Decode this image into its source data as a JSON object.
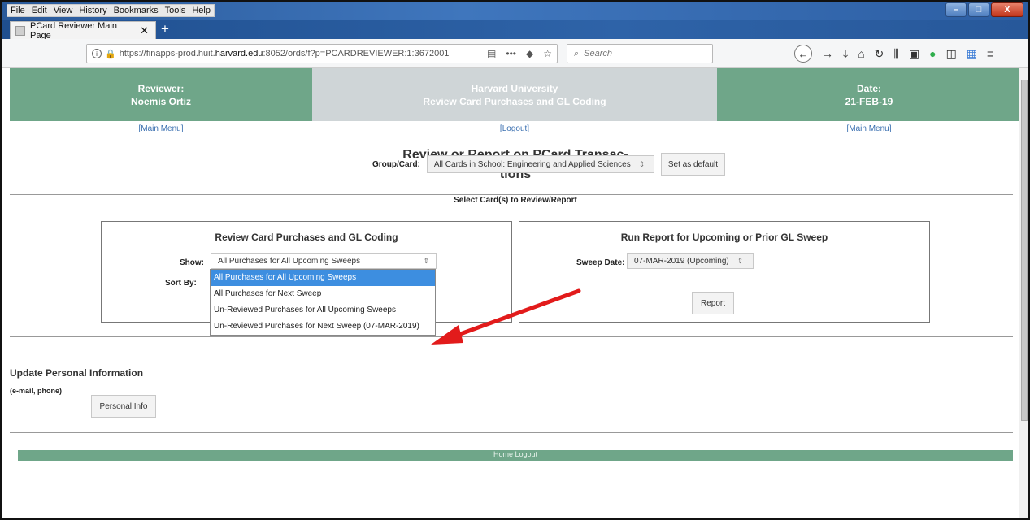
{
  "window": {
    "menu": [
      "File",
      "Edit",
      "View",
      "History",
      "Bookmarks",
      "Tools",
      "Help"
    ],
    "tab_title": "PCard Reviewer Main Page",
    "url_prefix": "https://finapps-prod.huit.",
    "url_host": "harvard.edu",
    "url_rest": ":8052/ords/f?p=PCARDREVIEWER:1:3672001",
    "search_placeholder": "Search"
  },
  "header": {
    "reviewer_label": "Reviewer:",
    "reviewer_name": "Noemis Ortiz",
    "org": "Harvard University",
    "app_title": "Review Card Purchases and GL Coding",
    "date_label": "Date:",
    "date_value": "21-FEB-19"
  },
  "links": {
    "main_menu_left": "[Main Menu]",
    "logout": "[Logout]",
    "main_menu_right": "[Main Menu]"
  },
  "page": {
    "title_line1": "Review or Report on PCard Transac-",
    "title_line2": "tions",
    "select_label": "Select Card(s) to Review/Report",
    "group_label": "Group/Card:",
    "group_value": "All Cards in School: Engineering and Applied Sciences",
    "default_button": "Set as default"
  },
  "review_box": {
    "title": "Review Card Purchases and GL Coding",
    "show_label": "Show:",
    "show_value": "All Purchases for All Upcoming Sweeps",
    "sort_label": "Sort By:",
    "options": [
      "All Purchases for All Upcoming Sweeps",
      "All Purchases for Next Sweep",
      "Un-Reviewed Purchases for All Upcoming Sweeps",
      "Un-Reviewed Purchases for Next Sweep (07-MAR-2019)"
    ]
  },
  "report_box": {
    "title": "Run Report for Upcoming or Prior GL Sweep",
    "sweep_label": "Sweep Date:",
    "sweep_value": "07-MAR-2019 (Upcoming)",
    "report_button": "Report"
  },
  "personal": {
    "title": "Update Personal Information",
    "subtitle": "(e-mail, phone)",
    "button": "Personal Info"
  },
  "footer": {
    "text": "Home   Logout"
  },
  "colors": {
    "header_green": "#6fa689",
    "header_gray": "#cfd5d7",
    "annotation_red": "#e21b1b",
    "highlight_blue": "#3d8ee0"
  }
}
